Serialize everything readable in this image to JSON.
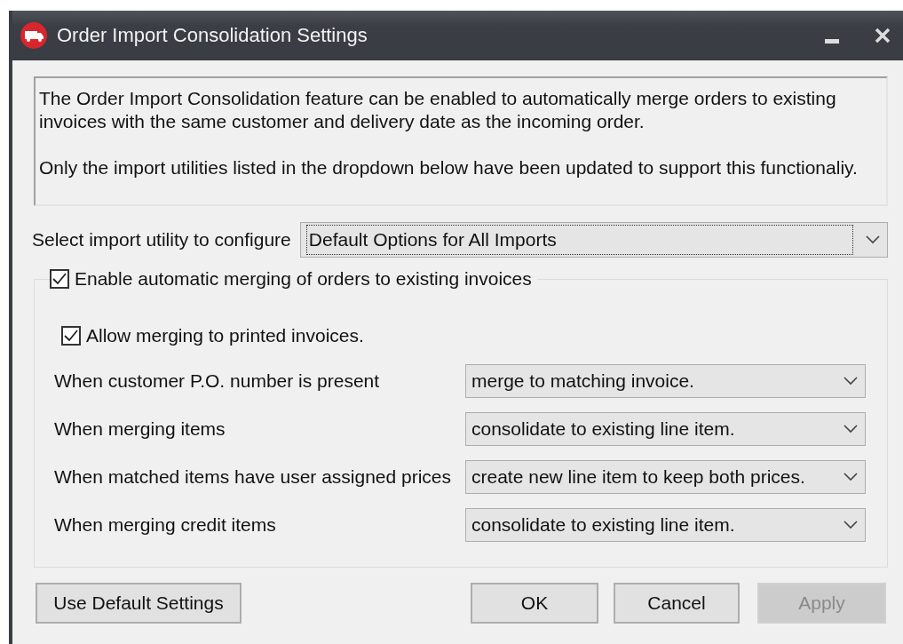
{
  "window": {
    "title": "Order Import Consolidation Settings"
  },
  "description": [
    "The Order Import Consolidation feature can be enabled to automatically merge orders to existing invoices with the same customer and delivery date as the incoming order.",
    "Only the import utilities listed in the dropdown below have been updated to support this functionaliy."
  ],
  "utility": {
    "label": "Select import utility to configure",
    "value": "Default Options for All Imports"
  },
  "enable_merging": {
    "label": "Enable automatic merging of orders to existing invoices",
    "checked": true
  },
  "allow_printed": {
    "label": "Allow merging to printed invoices.",
    "checked": true
  },
  "rules": [
    {
      "label": "When customer P.O. number is present",
      "value": "merge to matching invoice."
    },
    {
      "label": "When merging items",
      "value": "consolidate to existing line item."
    },
    {
      "label": "When matched items have user assigned prices",
      "value": "create new line item to keep both prices."
    },
    {
      "label": "When merging credit items",
      "value": "consolidate to existing line item."
    }
  ],
  "buttons": [
    {
      "label": "Use Default Settings",
      "disabled": false
    },
    {
      "label": "OK",
      "disabled": false
    },
    {
      "label": "Cancel",
      "disabled": false
    },
    {
      "label": "Apply",
      "disabled": true
    }
  ]
}
